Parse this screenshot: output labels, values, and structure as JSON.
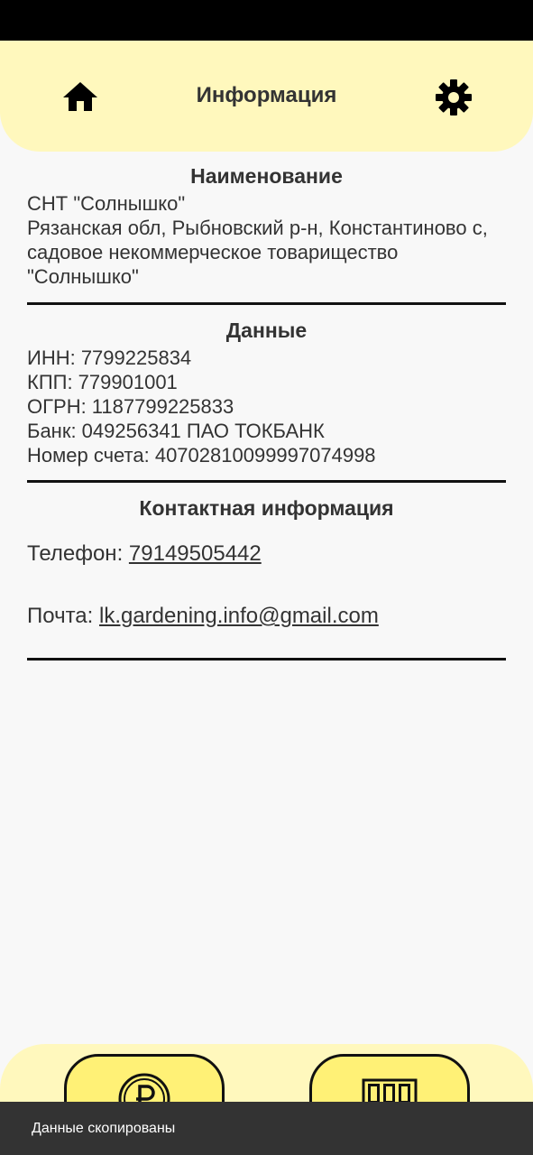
{
  "header": {
    "title": "Информация",
    "home_icon": "home-icon",
    "settings_icon": "gear-icon"
  },
  "sections": {
    "name": {
      "title": "Наименование",
      "lines": [
        "СНТ \"Солнышко\"",
        "Рязанская обл, Рыбновский р-н, Константиново с,",
        "садовое некоммерческое товарищество",
        "\"Солнышко\""
      ]
    },
    "data": {
      "title": "Данные",
      "lines": [
        "ИНН: 7799225834",
        "КПП: 779901001",
        "ОГРН: 1187799225833",
        "Банк: 049256341 ПАО ТОКБАНК",
        "Номер счета: 40702810099997074998"
      ]
    },
    "contacts": {
      "title": "Контактная информация",
      "phone_label": "Телефон: ",
      "phone_value": "79149505442",
      "email_label": "Почта: ",
      "email_value": "lk.gardening.info@gmail.com"
    }
  },
  "bottom_nav": {
    "payment_icon": "ruble-coin-icon",
    "meter_icon": "meter-counter-icon"
  },
  "toast": {
    "message": "Данные скопированы"
  },
  "colors": {
    "header_bg": "#fff8bd",
    "button_bg": "#fff176",
    "page_bg": "#f8f8f8",
    "toast_bg": "#333333"
  }
}
